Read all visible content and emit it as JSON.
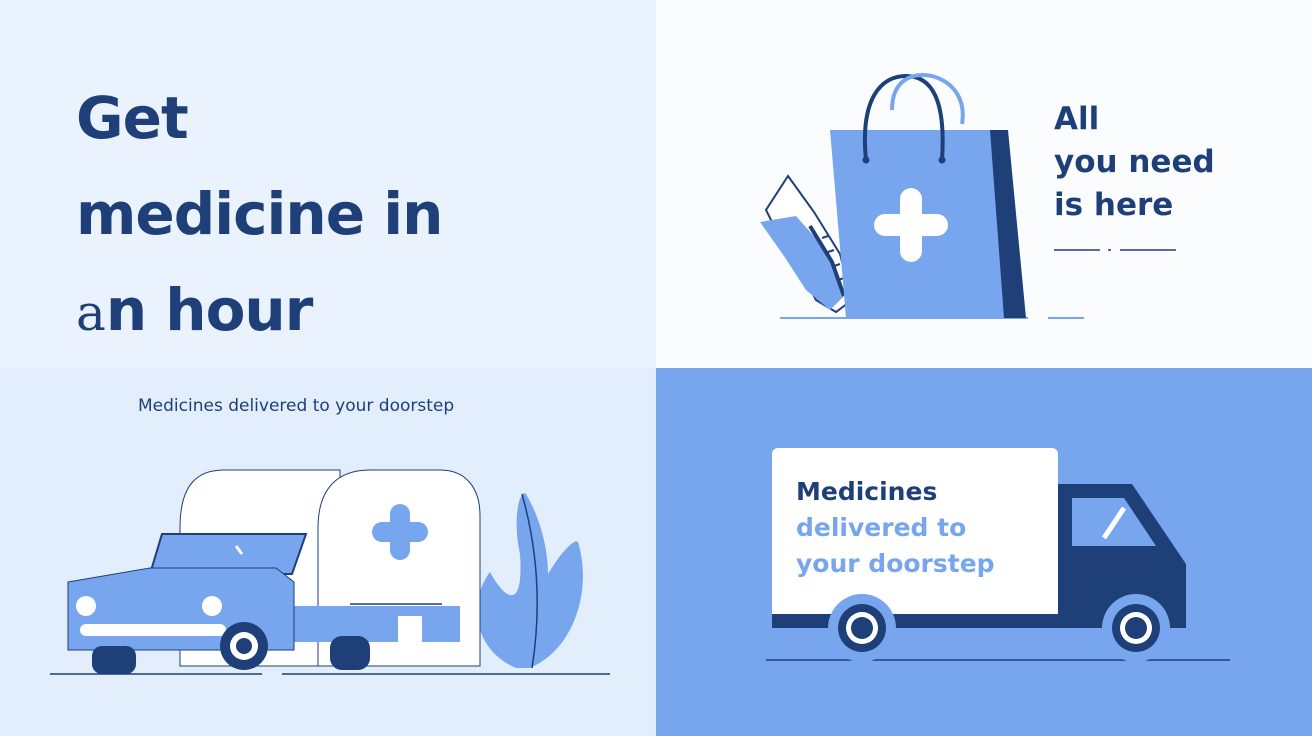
{
  "panel_top_left": {
    "headline_line1": "Get",
    "headline_line2": "medicine in",
    "headline_line3_thin": "a",
    "headline_line3_bold": "n hour"
  },
  "panel_top_right": {
    "title_line1": "All",
    "title_line2": "you need",
    "title_line3": "is here"
  },
  "panel_bottom_left": {
    "caption": "Medicines delivered to your doorstep"
  },
  "panel_bottom_right": {
    "truck_line1": "Medicines",
    "truck_line2": "delivered to",
    "truck_line3": "your doorstep"
  },
  "colors": {
    "navy": "#1e3f78",
    "blue": "#77a5ee",
    "pale": "#eaf3fd",
    "white": "#ffffff"
  },
  "icons": [
    "shopping-bag-icon",
    "medical-cross-icon",
    "car-icon",
    "ambulance-icon",
    "leaf-icon",
    "delivery-truck-icon"
  ]
}
